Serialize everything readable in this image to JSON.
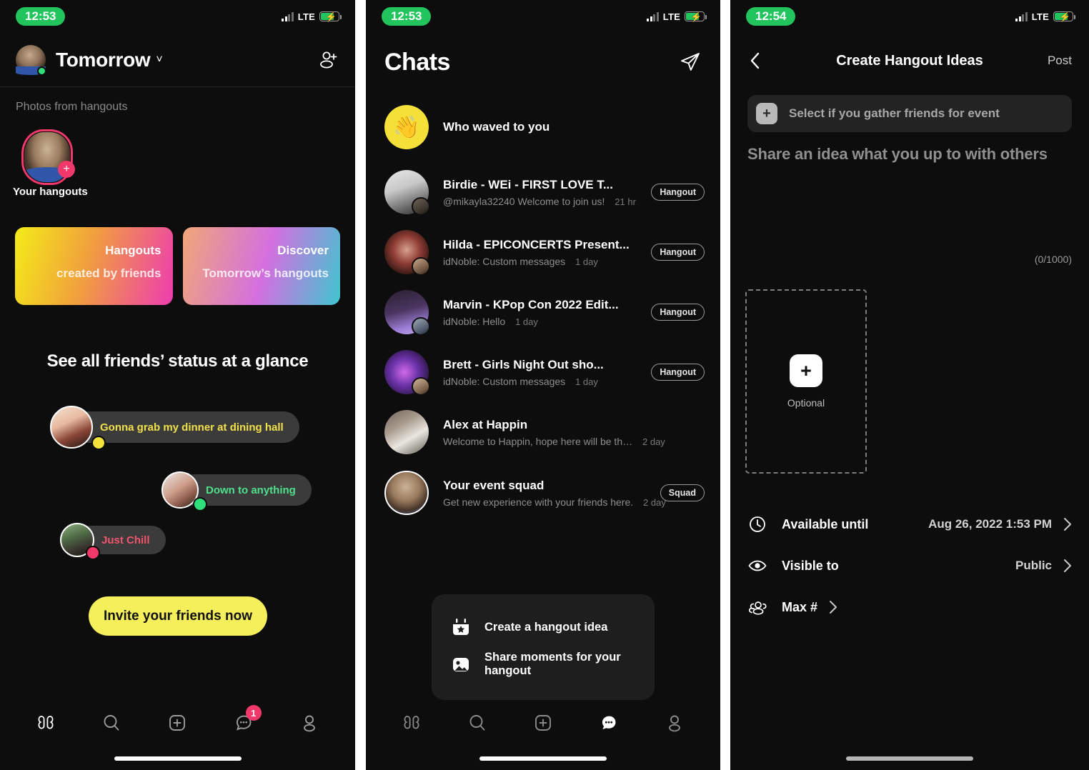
{
  "panel1": {
    "status": {
      "time": "12:53",
      "network": "LTE",
      "signal_icon": "signal-bars-icon",
      "battery_icon": "battery-charging-icon"
    },
    "header": {
      "title": "Tomorrow",
      "chevron_icon": "chevron-down-icon",
      "avatar_icon": "user-avatar",
      "add_friend_icon": "add-friend-icon"
    },
    "photos_section": {
      "label": "Photos from hangouts",
      "thumb_caption": "Your hangouts",
      "add_icon": "plus-icon"
    },
    "cards": [
      {
        "title": "Hangouts",
        "subtitle": "created by friends",
        "name": "hangouts-card"
      },
      {
        "title": "Discover",
        "subtitle": "Tomorrow’s hangouts",
        "name": "discover-card"
      }
    ],
    "glance_title": "See all friends’ status at a glance",
    "status_bubbles": [
      {
        "text": "Gonna grab my dinner at dining hall",
        "color": "#f0e04a",
        "dot": "#f5e23a"
      },
      {
        "text": "Down to anything",
        "color": "#4fe08c",
        "dot": "#2ee07a"
      },
      {
        "text": "Just Chill",
        "color": "#f0556e",
        "dot": "#f0386b"
      }
    ],
    "invite_button": "Invite your friends now",
    "nav": [
      {
        "label": "Home",
        "icon": "happin-logo-icon",
        "active": true,
        "badge": ""
      },
      {
        "label": "Search",
        "icon": "search-icon",
        "active": false,
        "badge": ""
      },
      {
        "label": "Create",
        "icon": "plus-square-icon",
        "active": false,
        "badge": ""
      },
      {
        "label": "Chats",
        "icon": "chat-bubble-icon",
        "active": false,
        "badge": "1"
      },
      {
        "label": "Profile",
        "icon": "person-icon",
        "active": false,
        "badge": ""
      }
    ]
  },
  "panel2": {
    "status": {
      "time": "12:53",
      "network": "LTE"
    },
    "header": {
      "title": "Chats",
      "send_icon": "paper-plane-icon"
    },
    "waved_row": {
      "label": "Who waved to you",
      "icon": "waving-hand-emoji"
    },
    "chats": [
      {
        "name": "Birdie - WEi - FIRST LOVE T...",
        "preview": "@mikayla32240 Welcome to join us!",
        "time": "21 hr",
        "tag": "Hangout"
      },
      {
        "name": "Hilda - EPICONCERTS Present...",
        "preview": "idNoble: Custom messages",
        "time": "1 day",
        "tag": "Hangout"
      },
      {
        "name": "Marvin - KPop Con 2022 Edit...",
        "preview": "idNoble: Hello",
        "time": "1 day",
        "tag": "Hangout"
      },
      {
        "name": "Brett - Girls Night Out sho...",
        "preview": "idNoble: Custom messages",
        "time": "1 day",
        "tag": "Hangout"
      },
      {
        "name": "Alex at Happin",
        "preview": "Welcome to Happin, hope here will be th…",
        "time": "2 day",
        "tag": ""
      },
      {
        "name": "Your event squad",
        "preview": "Get new experience with your friends here.",
        "time": "2 day",
        "tag": "Squad"
      }
    ],
    "action_sheet": [
      {
        "label": "Create a hangout idea",
        "icon": "calendar-star-icon"
      },
      {
        "label": "Share moments for your hangout",
        "icon": "photo-icon"
      }
    ],
    "nav": [
      {
        "label": "Home",
        "icon": "happin-logo-icon",
        "active": false,
        "badge": ""
      },
      {
        "label": "Search",
        "icon": "search-icon",
        "active": false,
        "badge": ""
      },
      {
        "label": "Create",
        "icon": "plus-square-icon",
        "active": false,
        "badge": ""
      },
      {
        "label": "Chats",
        "icon": "chat-bubble-icon",
        "active": true,
        "badge": ""
      },
      {
        "label": "Profile",
        "icon": "person-icon",
        "active": false,
        "badge": ""
      }
    ]
  },
  "panel3": {
    "status": {
      "time": "12:54",
      "network": "LTE"
    },
    "nav": {
      "back_icon": "chevron-left-icon",
      "title": "Create Hangout Ideas",
      "post_label": "Post"
    },
    "gather_field": {
      "placeholder": "Select if you gather friends for event",
      "plus_icon": "plus-icon"
    },
    "idea_placeholder": "Share an idea what you up to with others",
    "char_count": "(0/1000)",
    "media_drop": {
      "plus_icon": "plus-icon",
      "label": "Optional"
    },
    "options": [
      {
        "label": "Available until",
        "value": "Aug 26, 2022 1:53 PM",
        "icon": "clock-icon",
        "chevron": "chevron-right-icon"
      },
      {
        "label": "Visible to",
        "value": "Public",
        "icon": "eye-icon",
        "chevron": "chevron-right-icon"
      },
      {
        "label": "Max #",
        "value": "",
        "icon": "people-icon",
        "chevron": "chevron-right-icon"
      }
    ]
  }
}
